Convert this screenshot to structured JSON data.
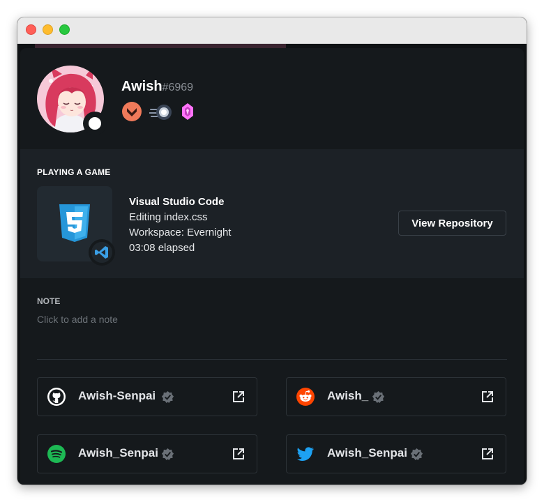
{
  "profile": {
    "username": "Awish",
    "discriminator": "#6969",
    "status": "online",
    "badges": [
      "hypesquad-bravery-icon",
      "nitro-icon",
      "boost-gem-icon"
    ]
  },
  "activity": {
    "header": "PLAYING A GAME",
    "name": "Visual Studio Code",
    "details": "Editing index.css",
    "state": "Workspace: Evernight",
    "elapsed": "03:08 elapsed",
    "large_image": "css3-icon",
    "small_image": "vscode-icon",
    "button_label": "View Repository"
  },
  "note": {
    "label": "NOTE",
    "placeholder": "Click to add a note"
  },
  "connections": [
    {
      "service": "github",
      "icon": "github-icon",
      "name": "Awish-Senpai",
      "verified": true
    },
    {
      "service": "reddit",
      "icon": "reddit-icon",
      "name": "Awish_",
      "verified": true
    },
    {
      "service": "spotify",
      "icon": "spotify-icon",
      "name": "Awish_Senpai",
      "verified": true
    },
    {
      "service": "twitter",
      "icon": "twitter-icon",
      "name": "Awish_Senpai",
      "verified": true
    }
  ],
  "colors": {
    "background": "#15191c",
    "activity_bg": "#1c2126",
    "status_online": "#ffffff",
    "reddit": "#ff4500",
    "spotify": "#1db954",
    "twitter": "#1da1f2",
    "css3": "#2596d9"
  }
}
